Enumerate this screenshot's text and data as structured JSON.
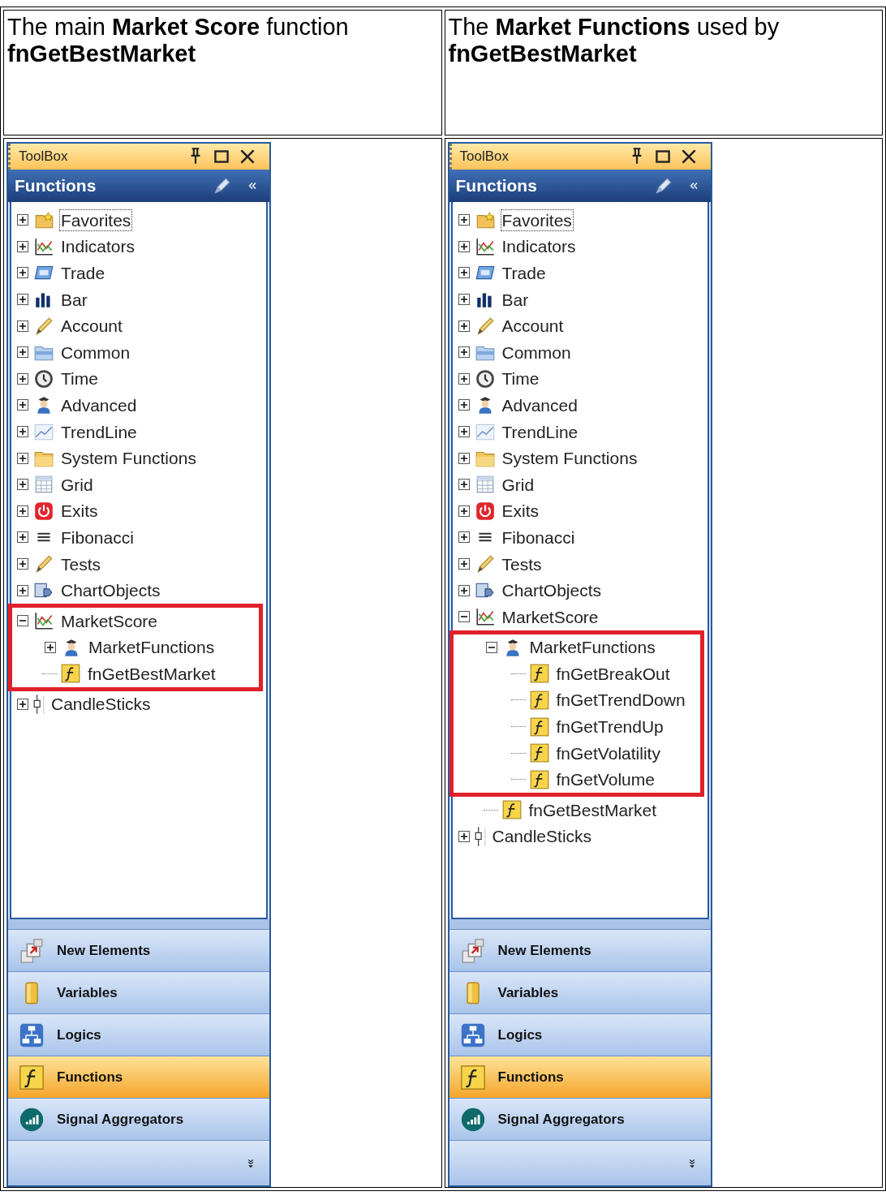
{
  "columns": [
    {
      "caption": [
        {
          "text": "The main **Market Score** function",
          "bold": false
        },
        {
          "text": "fnGetBestMarket",
          "bold": true
        }
      ],
      "panel": {
        "title": "ToolBox",
        "section_title": "Functions",
        "tree": [
          {
            "label": "Favorites",
            "kind": "favorites",
            "expanded": false,
            "selected": true
          },
          {
            "label": "Indicators",
            "kind": "indicators",
            "expanded": false,
            "selected": false
          },
          {
            "label": "Trade",
            "kind": "trade",
            "expanded": false,
            "selected": false
          },
          {
            "label": "Bar",
            "kind": "bar",
            "expanded": false,
            "selected": false
          },
          {
            "label": "Account",
            "kind": "pencil",
            "expanded": false,
            "selected": false
          },
          {
            "label": "Common",
            "kind": "common",
            "expanded": false,
            "selected": false
          },
          {
            "label": "Time",
            "kind": "clock",
            "expanded": false,
            "selected": false
          },
          {
            "label": "Advanced",
            "kind": "advanced",
            "expanded": false,
            "selected": false
          },
          {
            "label": "TrendLine",
            "kind": "trend",
            "expanded": false,
            "selected": false
          },
          {
            "label": "System Functions",
            "kind": "folder",
            "expanded": false,
            "selected": false
          },
          {
            "label": "Grid",
            "kind": "grid",
            "expanded": false,
            "selected": false
          },
          {
            "label": "Exits",
            "kind": "power",
            "expanded": false,
            "selected": false
          },
          {
            "label": "Fibonacci",
            "kind": "fibonacci",
            "expanded": false,
            "selected": false
          },
          {
            "label": "Tests",
            "kind": "pencil",
            "expanded": false,
            "selected": false
          },
          {
            "label": "ChartObjects",
            "kind": "chartobjects",
            "expanded": false,
            "selected": false
          },
          {
            "label": "MarketScore",
            "kind": "indicators",
            "expanded": true,
            "selected": false,
            "highlighted": true,
            "children": [
              {
                "label": "MarketFunctions",
                "kind": "advanced",
                "expanded": false,
                "selected": false
              },
              {
                "label": "fnGetBestMarket",
                "kind": "function",
                "selected": false
              }
            ]
          },
          {
            "label": "CandleSticks",
            "kind": "candle",
            "expanded": false,
            "selected": false
          }
        ],
        "nav": [
          {
            "label": "New Elements",
            "kind": "new",
            "selected": false
          },
          {
            "label": "Variables",
            "kind": "variables",
            "selected": false
          },
          {
            "label": "Logics",
            "kind": "logics",
            "selected": false
          },
          {
            "label": "Functions",
            "kind": "function",
            "selected": true
          },
          {
            "label": "Signal Aggregators",
            "kind": "signal",
            "selected": false
          }
        ]
      }
    },
    {
      "caption": [
        {
          "text": "The **Market Functions** used by",
          "bold": false
        },
        {
          "text": "fnGetBestMarket",
          "bold": true
        }
      ],
      "panel": {
        "title": "ToolBox",
        "section_title": "Functions",
        "tree": [
          {
            "label": "Favorites",
            "kind": "favorites",
            "expanded": false,
            "selected": true
          },
          {
            "label": "Indicators",
            "kind": "indicators",
            "expanded": false,
            "selected": false
          },
          {
            "label": "Trade",
            "kind": "trade",
            "expanded": false,
            "selected": false
          },
          {
            "label": "Bar",
            "kind": "bar",
            "expanded": false,
            "selected": false
          },
          {
            "label": "Account",
            "kind": "pencil",
            "expanded": false,
            "selected": false
          },
          {
            "label": "Common",
            "kind": "common",
            "expanded": false,
            "selected": false
          },
          {
            "label": "Time",
            "kind": "clock",
            "expanded": false,
            "selected": false
          },
          {
            "label": "Advanced",
            "kind": "advanced",
            "expanded": false,
            "selected": false
          },
          {
            "label": "TrendLine",
            "kind": "trend",
            "expanded": false,
            "selected": false
          },
          {
            "label": "System Functions",
            "kind": "folder",
            "expanded": false,
            "selected": false
          },
          {
            "label": "Grid",
            "kind": "grid",
            "expanded": false,
            "selected": false
          },
          {
            "label": "Exits",
            "kind": "power",
            "expanded": false,
            "selected": false
          },
          {
            "label": "Fibonacci",
            "kind": "fibonacci",
            "expanded": false,
            "selected": false
          },
          {
            "label": "Tests",
            "kind": "pencil",
            "expanded": false,
            "selected": false
          },
          {
            "label": "ChartObjects",
            "kind": "chartobjects",
            "expanded": false,
            "selected": false
          },
          {
            "label": "MarketScore",
            "kind": "indicators",
            "expanded": true,
            "selected": false,
            "children": [
              {
                "label": "MarketFunctions",
                "kind": "advanced",
                "expanded": true,
                "selected": false,
                "highlighted": true,
                "children": [
                  {
                    "label": "fnGetBreakOut",
                    "kind": "function",
                    "selected": false
                  },
                  {
                    "label": "fnGetTrendDown",
                    "kind": "function",
                    "selected": false
                  },
                  {
                    "label": "fnGetTrendUp",
                    "kind": "function",
                    "selected": false
                  },
                  {
                    "label": "fnGetVolatility",
                    "kind": "function",
                    "selected": false
                  },
                  {
                    "label": "fnGetVolume",
                    "kind": "function",
                    "selected": false
                  }
                ]
              },
              {
                "label": "fnGetBestMarket",
                "kind": "function",
                "selected": false
              }
            ]
          },
          {
            "label": "CandleSticks",
            "kind": "candle",
            "expanded": false,
            "selected": false
          }
        ],
        "nav": [
          {
            "label": "New Elements",
            "kind": "new",
            "selected": false
          },
          {
            "label": "Variables",
            "kind": "variables",
            "selected": false
          },
          {
            "label": "Logics",
            "kind": "logics",
            "selected": false
          },
          {
            "label": "Functions",
            "kind": "function",
            "selected": true
          },
          {
            "label": "Signal Aggregators",
            "kind": "signal",
            "selected": false
          }
        ]
      }
    }
  ]
}
